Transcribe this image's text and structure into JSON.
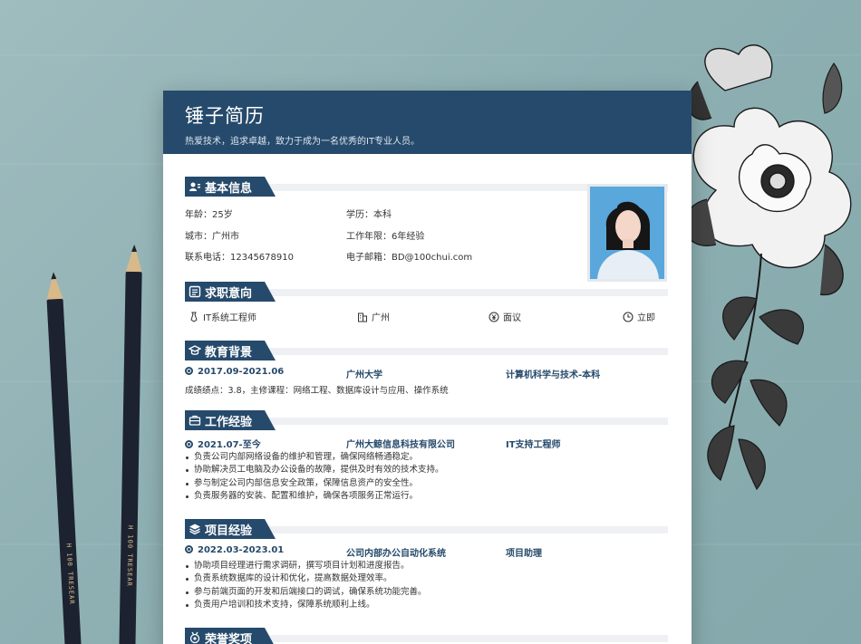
{
  "resume": {
    "name": "锤子简历",
    "motto": "热爱技术，追求卓越，致力于成为一名优秀的IT专业人员。"
  },
  "basic_info": {
    "title": "基本信息",
    "age": "年龄：25岁",
    "education": "学历：本科",
    "city": "城市：广州市",
    "experience_years": "工作年限：6年经验",
    "phone": "联系电话：12345678910",
    "email": "电子邮箱：BD@100chui.com"
  },
  "job_intent": {
    "title": "求职意向",
    "position": "IT系统工程师",
    "location": "广州",
    "salary": "面议",
    "availability": "立即"
  },
  "education": {
    "title": "教育背景",
    "period": "2017.09-2021.06",
    "school": "广州大学",
    "major": "计算机科学与技术-本科",
    "detail": "成绩绩点：3.8，主修课程：网络工程、数据库设计与应用、操作系统"
  },
  "work": {
    "title": "工作经验",
    "period": "2021.07-至今",
    "company": "广州大鲸信息科技有限公司",
    "role": "IT支持工程师",
    "duties": [
      "负责公司内部网络设备的维护和管理，确保网络畅通稳定。",
      "协助解决员工电脑及办公设备的故障，提供及时有效的技术支持。",
      "参与制定公司内部信息安全政策，保障信息资产的安全性。",
      "负责服务器的安装、配置和维护，确保各项服务正常运行。"
    ]
  },
  "project": {
    "title": "项目经验",
    "period": "2022.03-2023.01",
    "name": "公司内部办公自动化系统",
    "role": "项目助理",
    "duties": [
      "协助项目经理进行需求调研，撰写项目计划和进度报告。",
      "负责系统数据库的设计和优化，提高数据处理效率。",
      "参与前端页面的开发和后端接口的调试，确保系统功能完善。",
      "负责用户培训和技术支持，保障系统顺利上线。"
    ]
  },
  "honors": {
    "title": "荣誉奖项"
  },
  "pencil": {
    "brand": "H 100 TRESEAR"
  },
  "colors": {
    "primary": "#264a6b",
    "wall": "#8eb0b3"
  }
}
